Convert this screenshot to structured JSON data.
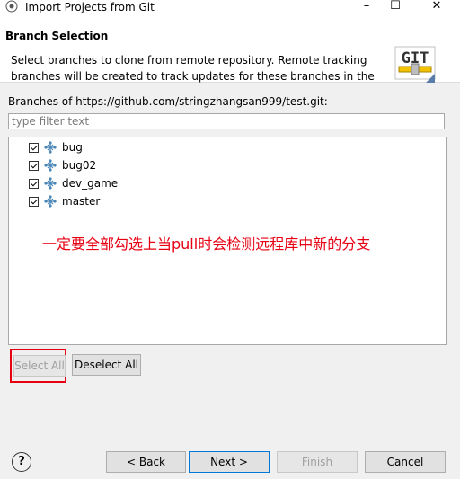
{
  "window": {
    "title": "Import Projects from Git",
    "minimize_glyph": "–",
    "maximize_glyph": "☐",
    "close_glyph": "✕"
  },
  "header": {
    "title": "Branch Selection",
    "description": "Select branches to clone from remote repository. Remote tracking branches will be created to track updates for these branches in the",
    "logo_text": "GIT"
  },
  "branches": {
    "label": "Branches of https://github.com/stringzhangsan999/test.git:",
    "filter_placeholder": "type filter text",
    "items": [
      {
        "name": "bug",
        "checked": true
      },
      {
        "name": "bug02",
        "checked": true
      },
      {
        "name": "dev_game",
        "checked": true
      },
      {
        "name": "master",
        "checked": true
      }
    ]
  },
  "annotation": "一定要全部勾选上当pull时会检测远程库中新的分支",
  "buttons": {
    "select_all": "Select All",
    "deselect_all": "Deselect All",
    "back": "< Back",
    "next": "Next >",
    "finish": "Finish",
    "cancel": "Cancel",
    "help": "?"
  },
  "icons": {
    "app": "eclipse-icon",
    "branch": "git-branch-icon",
    "help": "help-icon"
  },
  "colors": {
    "annotation_red": "#e60012",
    "default_button_border": "#0078d7"
  }
}
